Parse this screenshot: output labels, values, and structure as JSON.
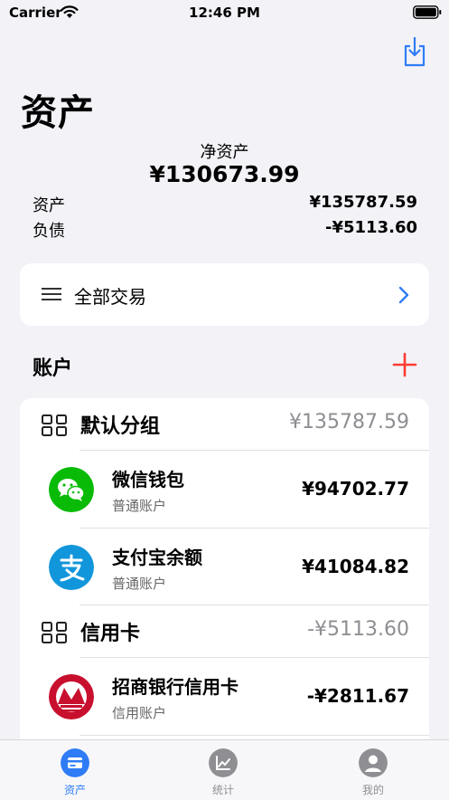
{
  "status": {
    "carrier": "Carrier",
    "time": "12:46 PM"
  },
  "header": {
    "title": "资产"
  },
  "summary": {
    "net_label": "净资产",
    "net_value": "¥130673.99",
    "assets_label": "资产",
    "assets_value": "¥135787.59",
    "debt_label": "负债",
    "debt_value": "-¥5113.60"
  },
  "transactions": {
    "label": "全部交易"
  },
  "accounts": {
    "title": "账户",
    "groups": [
      {
        "name": "默认分组",
        "amount": "¥135787.59",
        "items": [
          {
            "name": "微信钱包",
            "type": "普通账户",
            "amount": "¥94702.77",
            "icon": "wechat-icon"
          },
          {
            "name": "支付宝余额",
            "type": "普通账户",
            "amount": "¥41084.82",
            "icon": "alipay-icon"
          }
        ]
      },
      {
        "name": "信用卡",
        "amount": "-¥5113.60",
        "items": [
          {
            "name": "招商银行信用卡",
            "type": "信用账户",
            "amount": "-¥2811.67",
            "icon": "cmb-icon"
          }
        ]
      }
    ]
  },
  "tabs": [
    {
      "label": "资产",
      "active": true,
      "icon": "card-icon"
    },
    {
      "label": "统计",
      "active": false,
      "icon": "chart-icon"
    },
    {
      "label": "我的",
      "active": false,
      "icon": "person-icon"
    }
  ],
  "colors": {
    "accent": "#2f7cf6",
    "add": "#ff3b30",
    "background": "#f2f2f7",
    "wechat": "#09bb07",
    "alipay": "#1296db",
    "cmb": "#c8102e",
    "inactive_tab": "#8e8e93"
  }
}
